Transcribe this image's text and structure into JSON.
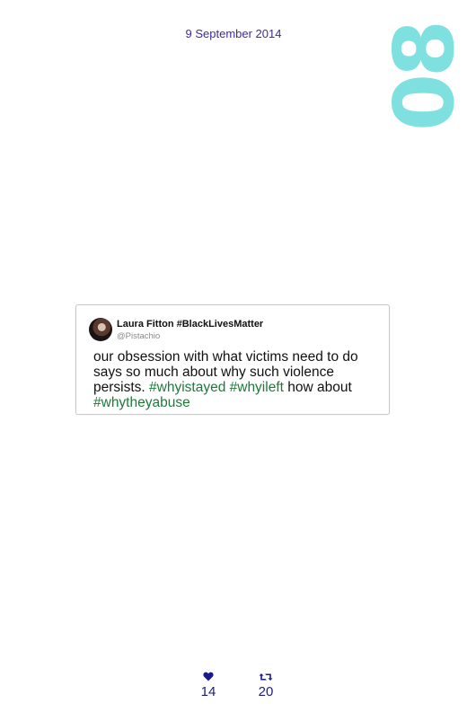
{
  "header": {
    "date": "9 September 2014",
    "number": "08",
    "number_color": "#7fe0e0"
  },
  "tweet": {
    "author_name": "Laura Fitton #BlackLivesMatter",
    "author_handle": "@Pistachio",
    "text_part1": "our obsession with what victims need to do says so much about why such violence persists. ",
    "hashtag1": "#whyistayed",
    "hashtag2": "#whyileft",
    "text_part2": " how about ",
    "hashtag3": "#whytheyabuse",
    "hashtag_color": "#1f7a3a"
  },
  "stats": {
    "likes": "14",
    "retweets": "20",
    "like_icon": "heart-icon",
    "retweet_icon": "retweet-icon",
    "color": "#1a1a8c"
  }
}
